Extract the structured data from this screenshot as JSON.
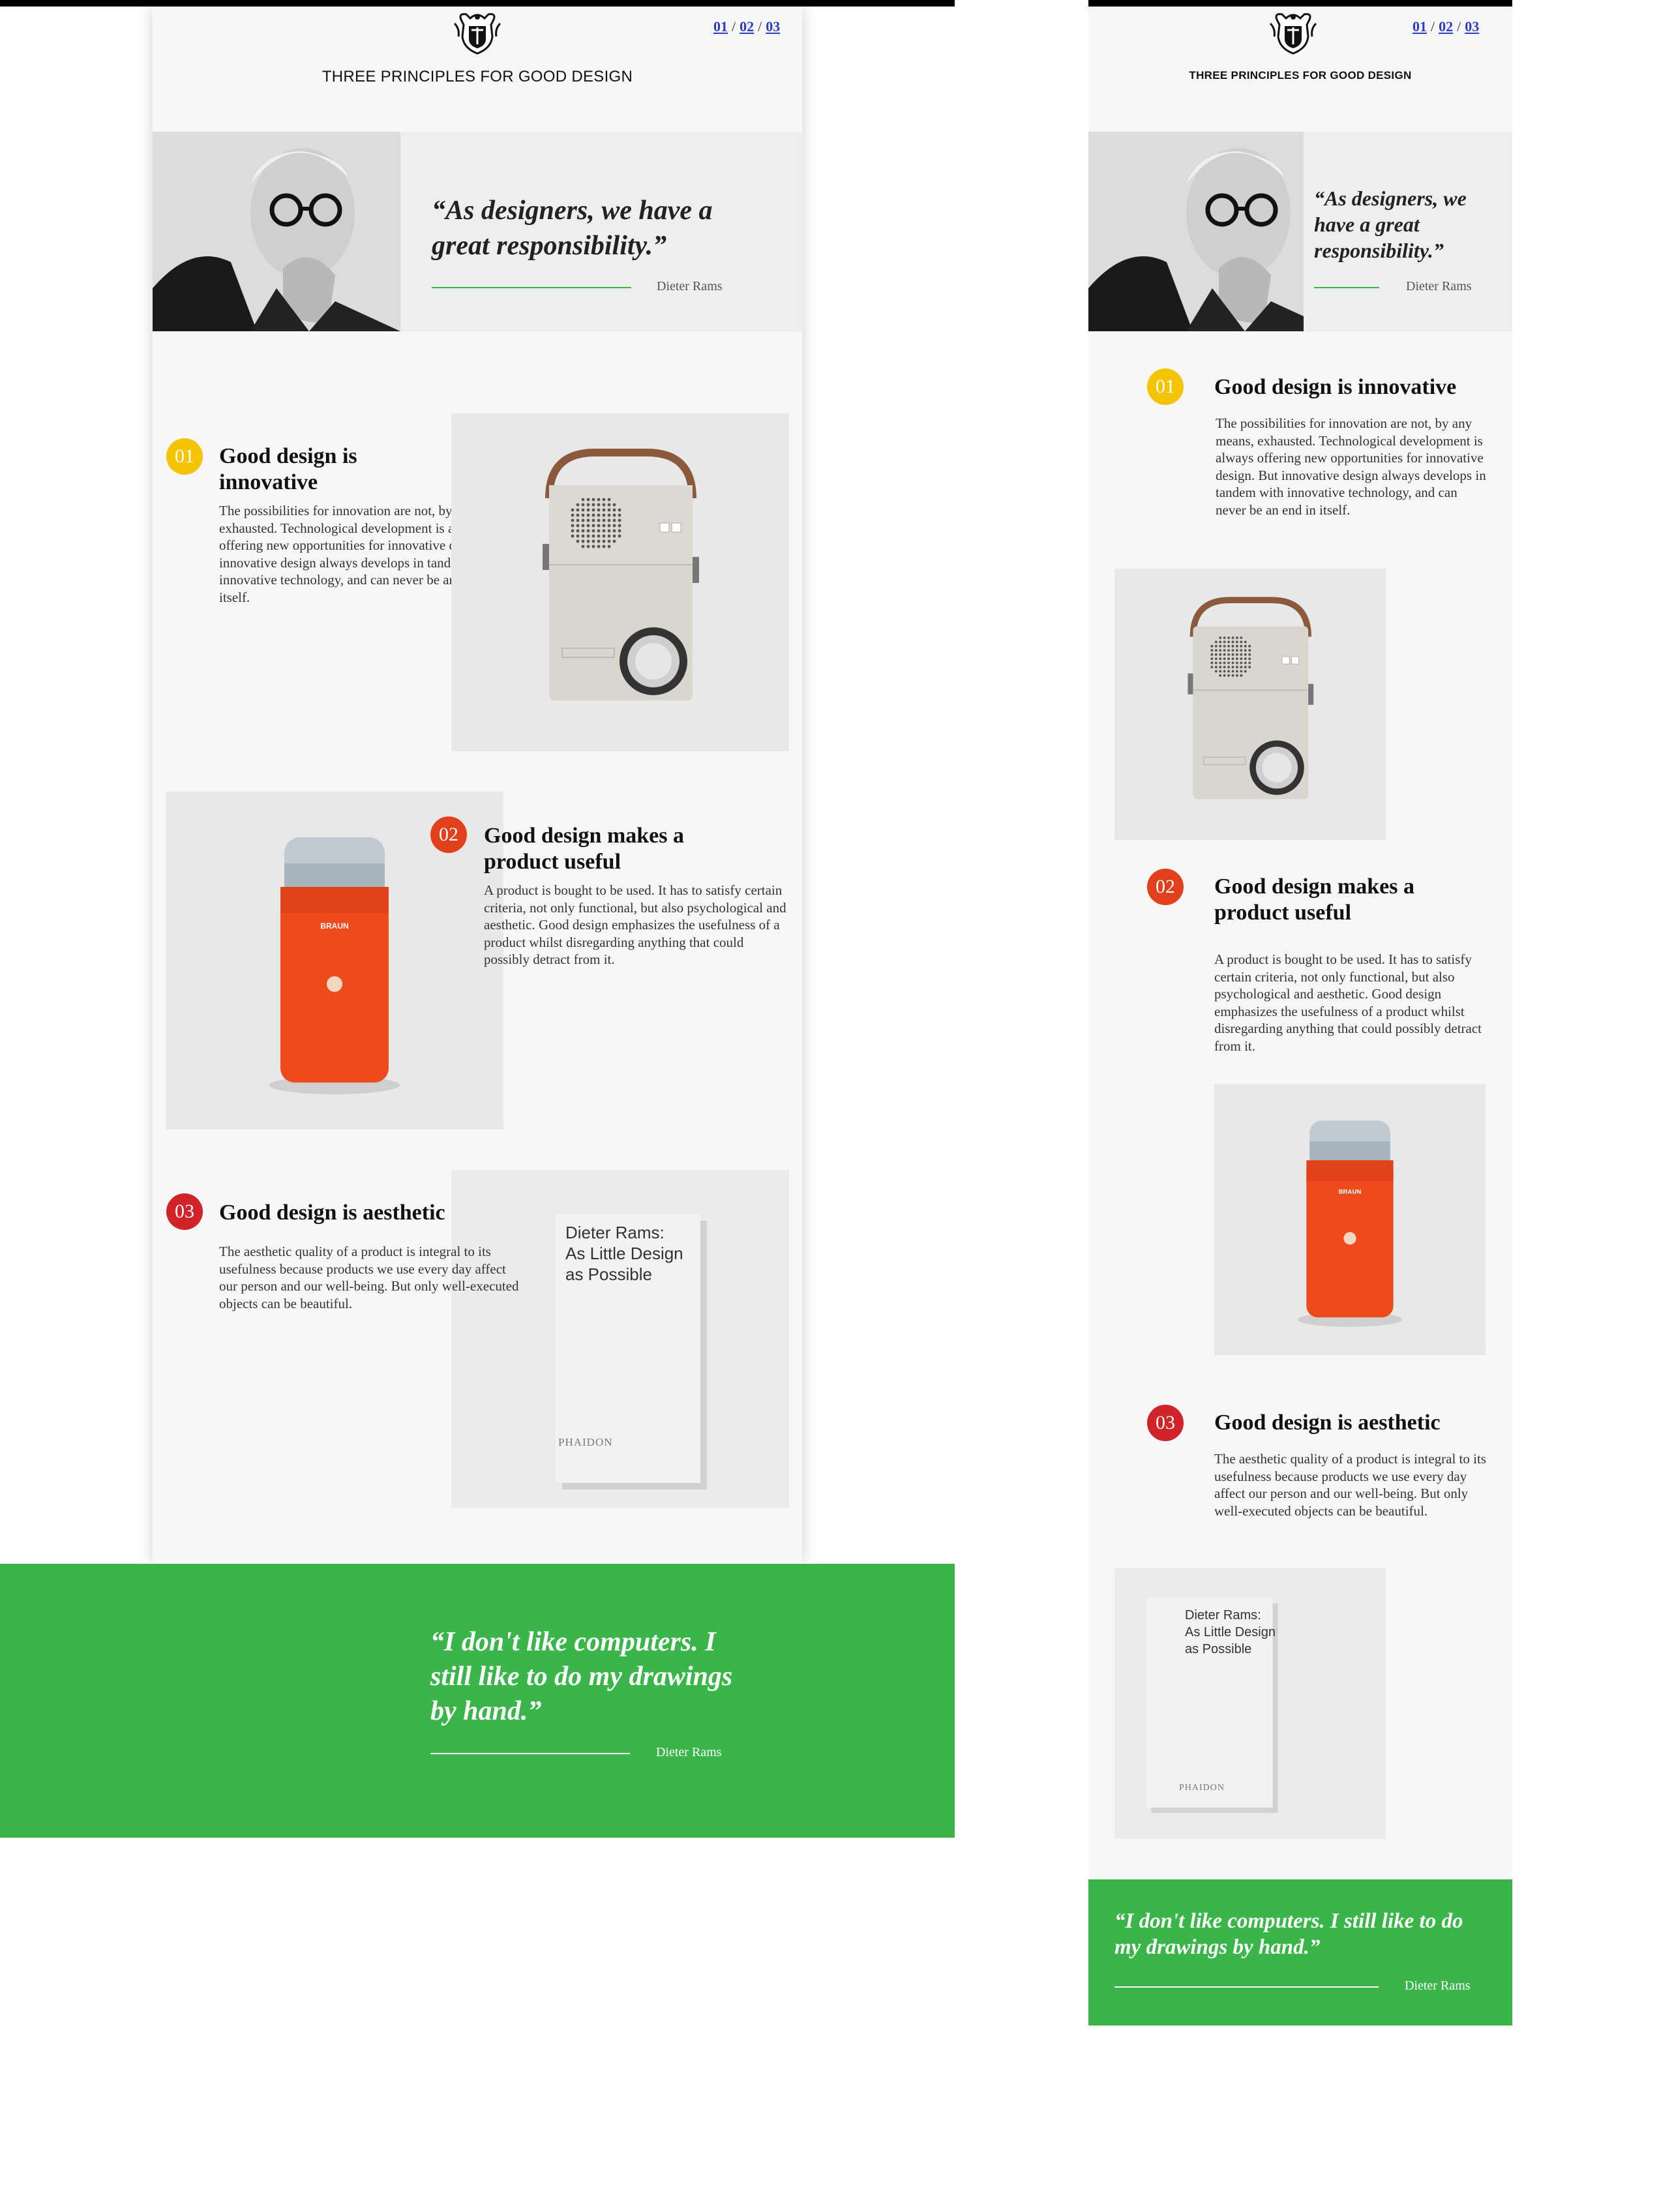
{
  "site": {
    "title": "THREE PRINCIPLES FOR GOOD DESIGN",
    "pager": [
      "01",
      "02",
      "03"
    ],
    "pager_separator": "/"
  },
  "hero": {
    "quote": "“As designers, we have a great responsibility.”",
    "author": "Dieter Rams"
  },
  "principles": [
    {
      "number": "01",
      "title": "Good design is innovative",
      "body": "The possibilities for innovation are not, by any means, exhausted. Technological development is always offering new opportunities for innovative design. But innovative design always develops in tandem with innovative technology, and can never be an end in itself.",
      "image": "radio-speaker-image"
    },
    {
      "number": "02",
      "title": "Good design makes a product useful",
      "body": "A product is bought to be used. It has to satisfy certain criteria, not only functional, but also psychological and aesthetic. Good design emphasizes the usefulness of a product whilst disregarding anything that could possibly detract from it.",
      "image": "coffee-grinder-image"
    },
    {
      "number": "03",
      "title": "Good design is aesthetic",
      "body": "The aesthetic quality of a product is integral to its usefulness because products we use every day affect our person and our well-being. But only well-executed objects can be beautiful.",
      "image": "book-image"
    }
  ],
  "book": {
    "line1": "Dieter Rams:",
    "line2": "As Little Design",
    "line3": "as Possible",
    "publisher": "PHAIDON"
  },
  "grinder_brand": "BRAUN",
  "footer_quote": {
    "quote": "“I don't like computers. I still like to do my drawings by hand.”",
    "author": "Dieter Rams"
  },
  "colors": {
    "accent_green": "#3ab54a",
    "badge_yellow": "#f5c400",
    "badge_orange": "#e2401c",
    "badge_red": "#d0232a",
    "link_blue": "#2a3cc7"
  }
}
